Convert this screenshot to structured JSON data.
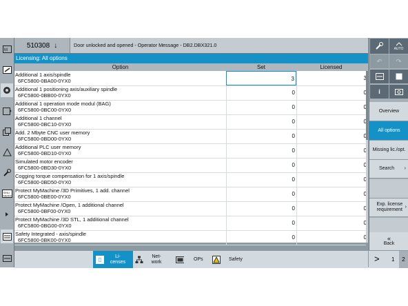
{
  "header": {
    "alarm_number": "510308",
    "alarm_arrow": "↓",
    "alarm_text": "Door unlocked and opened - Operator Message - DB2.DBX321.0"
  },
  "title": "Licensing: All options",
  "columns": {
    "option": "Option",
    "set": "Set",
    "licensed": "Licensed"
  },
  "rows": [
    {
      "name": "Additional 1 axis/spindle",
      "code": "6FC5800-0BA00-0YX0",
      "set": "3",
      "licensed": "3"
    },
    {
      "name": "Additional 1 positioning axis/auxiliary spindle",
      "code": "6FC5800-0BB00-0YX0",
      "set": "0",
      "licensed": "0"
    },
    {
      "name": "Additional 1 operation mode modul (BAG)",
      "code": "6FC5800-0BC00-0YX0",
      "set": "0",
      "licensed": "0"
    },
    {
      "name": "Additional 1 channel",
      "code": "6FC5800-0BC10-0YX0",
      "set": "0",
      "licensed": "0"
    },
    {
      "name": "Add. 2 Mbyte CNC user memory",
      "code": "6FC5800-0BD00-0YX0",
      "set": "0",
      "licensed": "0"
    },
    {
      "name": "Additional PLC user memory",
      "code": "6FC5800-0BD10-0YX0",
      "set": "0",
      "licensed": "0"
    },
    {
      "name": "Simulated motor encoder",
      "code": "6FC5800-0BD30-0YX0",
      "set": "0",
      "licensed": "0"
    },
    {
      "name": "Cogging torque compensation for 1 axis/spindle",
      "code": "6FC5800-0BD50-0YX0",
      "set": "0",
      "licensed": "0"
    },
    {
      "name": "Protect MyMachine /3D Primitives, 1 add. channel",
      "code": "6FC5800-0BE00-0YX0",
      "set": "0",
      "licensed": "0"
    },
    {
      "name": "Protect MyMachine /Open, 1 additional channel",
      "code": "6FC5800-0BF00-0YX0",
      "set": "0",
      "licensed": "0"
    },
    {
      "name": "Protect MyMachine /3D STL, 1 additional channel",
      "code": "6FC5800-0BG00-0YX0",
      "set": "0",
      "licensed": "0"
    },
    {
      "name": "Safety Integrated - axis/spindle",
      "code": "6FC5800-0BK00-0YX0",
      "set": "0",
      "licensed": "0"
    }
  ],
  "softkeys": {
    "overview": "Overview",
    "all_options": "All options",
    "missing": "Missing lic./opt.",
    "search": "Search",
    "exp_license": "Exp. license requirement",
    "back_arrow": "«",
    "back": "Back"
  },
  "bottom": {
    "licenses": "Li-censes",
    "network": "Net-work",
    "ops": "OPs",
    "safety": "Safety",
    "next": ">",
    "page1": "1",
    "page2": "2"
  },
  "icons": {
    "auto_label": "AUTO",
    "info": "i"
  },
  "colors": {
    "accent": "#1492c8",
    "panel": "#a7b0b6",
    "softkey": "#d3dadf"
  }
}
